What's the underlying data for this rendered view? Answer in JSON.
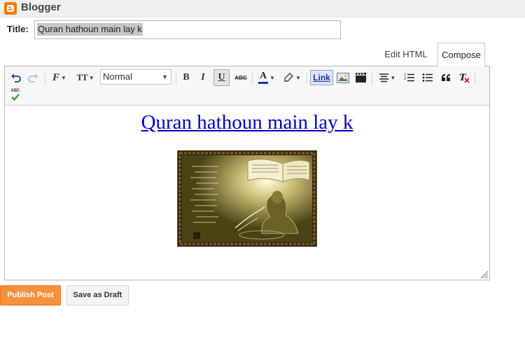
{
  "app": {
    "brand": "Blogger"
  },
  "post": {
    "title_label": "Title:",
    "title_value": "Quran hathoun main lay k",
    "body_heading": "Quran hathoun main lay k"
  },
  "tabs": [
    {
      "label": "Edit HTML",
      "active": false
    },
    {
      "label": "Compose",
      "active": true
    }
  ],
  "toolbar": {
    "format_value": "Normal",
    "link_label": "Link",
    "spellcheck_label": "ABC",
    "strikethrough_label": "ABC",
    "bold_label": "B",
    "italic_label": "I",
    "underline_label": "U",
    "text_color_label": "A",
    "font_label": "F",
    "font_size_label": "TT"
  },
  "actions": {
    "publish_label": "Publish Post",
    "draft_label": "Save as Draft"
  },
  "colors": {
    "accent": "#f5913b",
    "link": "#0000cc",
    "text_color_bar": "#1a2fbf"
  }
}
